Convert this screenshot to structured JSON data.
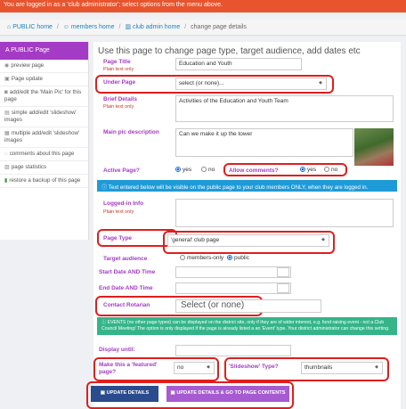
{
  "topbar": {
    "text": "You are logged in as a 'club administrator'; select options from the menu above."
  },
  "breadcrumb": [
    "PUBLIC home",
    "members home",
    "club admin home",
    "change page details"
  ],
  "sidebar": {
    "title": "A PUBLIC Page",
    "items": [
      {
        "icon": "preview-icon",
        "label": "preview page"
      },
      {
        "icon": "page-update-icon",
        "label": "Page update"
      },
      {
        "icon": "camera-icon",
        "label": "add/edit the 'Main Pic' for this page"
      },
      {
        "icon": "slideshow-icon",
        "label": "simple add/edit 'slideshow' images"
      },
      {
        "icon": "slideshow-multi-icon",
        "label": "multiple add/edit 'slideshow' images"
      },
      {
        "icon": "comment-icon",
        "label": "comments about this page"
      },
      {
        "icon": "stats-icon",
        "label": "page statistics"
      },
      {
        "icon": "backup-icon",
        "label": "restore a backup of this page"
      }
    ]
  },
  "main": {
    "heading": "Use this page to change page type, target audience, add dates etc",
    "plain_text_only": "Plain text only",
    "page_title_label": "Page Title",
    "page_title_value": "Education and Youth",
    "under_page_label": "Under Page",
    "under_page_value": "select (or none)...",
    "brief_details_label": "Brief Details",
    "brief_details_value": "Activities of the Education and Youth Team",
    "main_pic_label": "Main pic description",
    "main_pic_value": "Can we make it up the tower",
    "active_page_label": "Active Page?",
    "allow_comments_label": "Allow comments?",
    "yes": "yes",
    "no": "no",
    "info_text": "Text entered below will be visible on the public page to your club members ONLY, when they are logged in.",
    "logged_in_info_label": "Logged-in Info",
    "page_type_label": "Page Type",
    "page_type_value": "'general' club page",
    "target_audience_label": "Target audience",
    "members_only": "members-only",
    "public": "public",
    "start_date_label": "Start Date AND Time",
    "end_date_label": "End Date AND Time",
    "contact_label": "Contact Rotarian",
    "contact_value": "Select (or none)",
    "events_note": "EVENTS (no other page types) can be displayed on the district site, only if they are of wider interest, e.g. fund raising event - not a Club Council Meeting! The option is only displayed if the page is already listed a an 'Event' type. Your district administrator can change this setting.",
    "display_until_label": "Display until:",
    "featured_label": "Make this a 'featured' page?",
    "featured_value": "no",
    "slideshow_type_label": "'Slideshow' Type?",
    "slideshow_type_value": "thumbnails",
    "update_button": "UPDATE DETAILS",
    "update_go_button": "UPDATE DETAILS & GO TO PAGE CONTENTS"
  },
  "colors": {
    "accent": "#a43bc4",
    "topbar": "#e8542d",
    "primary_button": "#2a4b8d",
    "secondary_button": "#a75bd0",
    "info": "#1e9bd7",
    "note": "#35b48a",
    "highlight": "#e01e1e"
  }
}
